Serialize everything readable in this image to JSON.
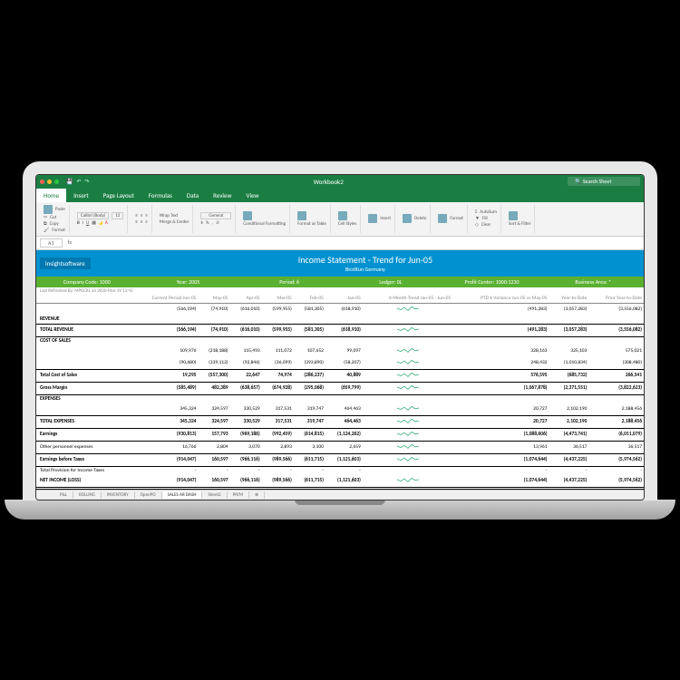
{
  "window": {
    "title": "Workbook2",
    "search": "Search Sheet"
  },
  "ribbonTabs": [
    "Home",
    "Insert",
    "Page Layout",
    "Formulas",
    "Data",
    "Review",
    "View"
  ],
  "ribbon": {
    "paste": "Paste",
    "cut": "Cut",
    "copy": "Copy",
    "format": "Format",
    "font": "Calibri (Body)",
    "size": "12",
    "wrap": "Wrap Text",
    "merge": "Merge & Center",
    "numfmt": "General",
    "cond": "Conditional Formatting",
    "table": "Format as Table",
    "styles": "Cell Styles",
    "insert": "Insert",
    "delete": "Delete",
    "formatc": "Format",
    "autosum": "AutoSum",
    "fill": "Fill",
    "clear": "Clear",
    "sort": "Sort & Filter"
  },
  "formula": {
    "cell": "A1",
    "fx": "fx"
  },
  "report": {
    "logo": "insightsoftware",
    "title": "Income Statement - Trend for Jun-05",
    "subtitle": "BestRun Germany",
    "params": {
      "ccLbl": "Company Code:",
      "cc": "1000",
      "yrLbl": "Year: 2005",
      "prdLbl": "Period: 6",
      "ldgLbl": "Ledger: 0L",
      "pcLbl": "Profit Center: 1000:1230",
      "baLbl": "Business Area: *"
    },
    "refresh": "Last Refreshed By: MPOCKL on 2020-Mar-19  13:43",
    "cols": [
      "",
      "Current Period Jun-05",
      "May-05",
      "Apr-05",
      "Mar-05",
      "Feb-05",
      "Jan-05",
      "6-Month Trend Jan-05 - Jun-05",
      "PTD $ Variance Jun-05 vs May-05",
      "Year-to-Date",
      "Prior Year-to-Date"
    ],
    "rows": [
      {
        "lbl": "",
        "v": [
          "(566,194)",
          "(74,910)",
          "(616,010)",
          "(599,955)",
          "(581,305)",
          "(618,910)",
          "~",
          "(491,283)",
          "(3,057,283)",
          "(3,556,082)"
        ]
      },
      {
        "lbl": "REVENUE",
        "bold": true,
        "v": [
          "",
          "",
          "",
          "",
          "",
          "",
          "",
          "",
          "",
          ""
        ]
      },
      {
        "lbl": "TOTAL REVENUE",
        "bold": true,
        "total": true,
        "v": [
          "(566,194)",
          "(74,910)",
          "(616,010)",
          "(599,955)",
          "(581,305)",
          "(618,910)",
          "~",
          "(491,283)",
          "(3,057,283)",
          "(3,556,082)"
        ]
      },
      {
        "lbl": "COST OF SALES",
        "bold": true,
        "v": [
          "",
          "",
          "",
          "",
          "",
          "",
          "",
          "",
          "",
          ""
        ]
      },
      {
        "lbl": "",
        "v": [
          "109,976",
          "(218,188)",
          "115,493",
          "111,072",
          "107,652",
          "99,097",
          "~",
          "328,163",
          "325,103",
          "575,021"
        ]
      },
      {
        "lbl": "",
        "v": [
          "(90,680)",
          "(339,112)",
          "(92,846)",
          "(36,099)",
          "(393,890)",
          "(58,207)",
          "~",
          "248,432",
          "(1,010,834)",
          "(308,480)"
        ]
      },
      {
        "lbl": "Total Cost of Sales",
        "bold": true,
        "total": true,
        "v": [
          "19,295",
          "(557,300)",
          "22,647",
          "74,974",
          "(286,237)",
          "40,889",
          "~",
          "576,595",
          "(685,732)",
          "266,541"
        ]
      },
      {
        "lbl": "Gross Margin",
        "bold": true,
        "total": true,
        "v": [
          "(585,489)",
          "482,389",
          "(638,657)",
          "(674,928)",
          "(295,068)",
          "(659,799)",
          "~",
          "(1,067,878)",
          "(2,371,551)",
          "(3,822,623)"
        ]
      },
      {
        "lbl": "EXPENSES",
        "bold": true,
        "v": [
          "",
          "",
          "",
          "",
          "",
          "",
          "",
          "",
          "",
          ""
        ]
      },
      {
        "lbl": "",
        "v": [
          "345,324",
          "324,597",
          "330,529",
          "317,531",
          "319,747",
          "464,463",
          "~",
          "20,727",
          "2,102,190",
          "2,188,456"
        ]
      },
      {
        "lbl": "TOTAL EXPENSES",
        "bold": true,
        "total": true,
        "v": [
          "345,324",
          "324,597",
          "330,529",
          "317,531",
          "319,747",
          "464,463",
          "~",
          "20,727",
          "2,102,190",
          "2,188,456"
        ]
      },
      {
        "lbl": "Earnings",
        "bold": true,
        "total": true,
        "v": [
          "(930,813)",
          "157,793",
          "(969,186)",
          "(992,459)",
          "(614,815)",
          "(1,124,262)",
          "~",
          "(1,088,606)",
          "(4,473,741)",
          "(6,011,079)"
        ]
      },
      {
        "lbl": "Other personnel expenses",
        "v": [
          "16,766",
          "2,804",
          "3,070",
          "2,893",
          "3,100",
          "2,659",
          "~",
          "13,961",
          "36,517",
          "36,517"
        ]
      },
      {
        "lbl": "Earnings before Taxes",
        "bold": true,
        "total": true,
        "v": [
          "(914,047)",
          "160,597",
          "(966,116)",
          "(989,566)",
          "(611,715)",
          "(1,121,603)",
          "~",
          "(1,074,644)",
          "(4,437,225)",
          "(5,974,562)"
        ]
      },
      {
        "lbl": "Total Provision for Income Taxes",
        "v": [
          "-",
          "-",
          "-",
          "-",
          "-",
          "-",
          "",
          "-",
          "-",
          "-"
        ]
      },
      {
        "lbl": "NET INCOME (LOSS)",
        "bold": true,
        "dbl": true,
        "v": [
          "(914,047)",
          "160,597",
          "(966,116)",
          "(989,566)",
          "(611,715)",
          "(1,121,603)",
          "~",
          "(1,074,644)",
          "(4,437,225)",
          "(5,974,562)"
        ]
      }
    ]
  },
  "sheetTabs": [
    "P&L",
    "ROLLING",
    "INVENTORY",
    "OpenPO",
    "SALES AR DASH",
    "Sheet2",
    "PAYM"
  ]
}
